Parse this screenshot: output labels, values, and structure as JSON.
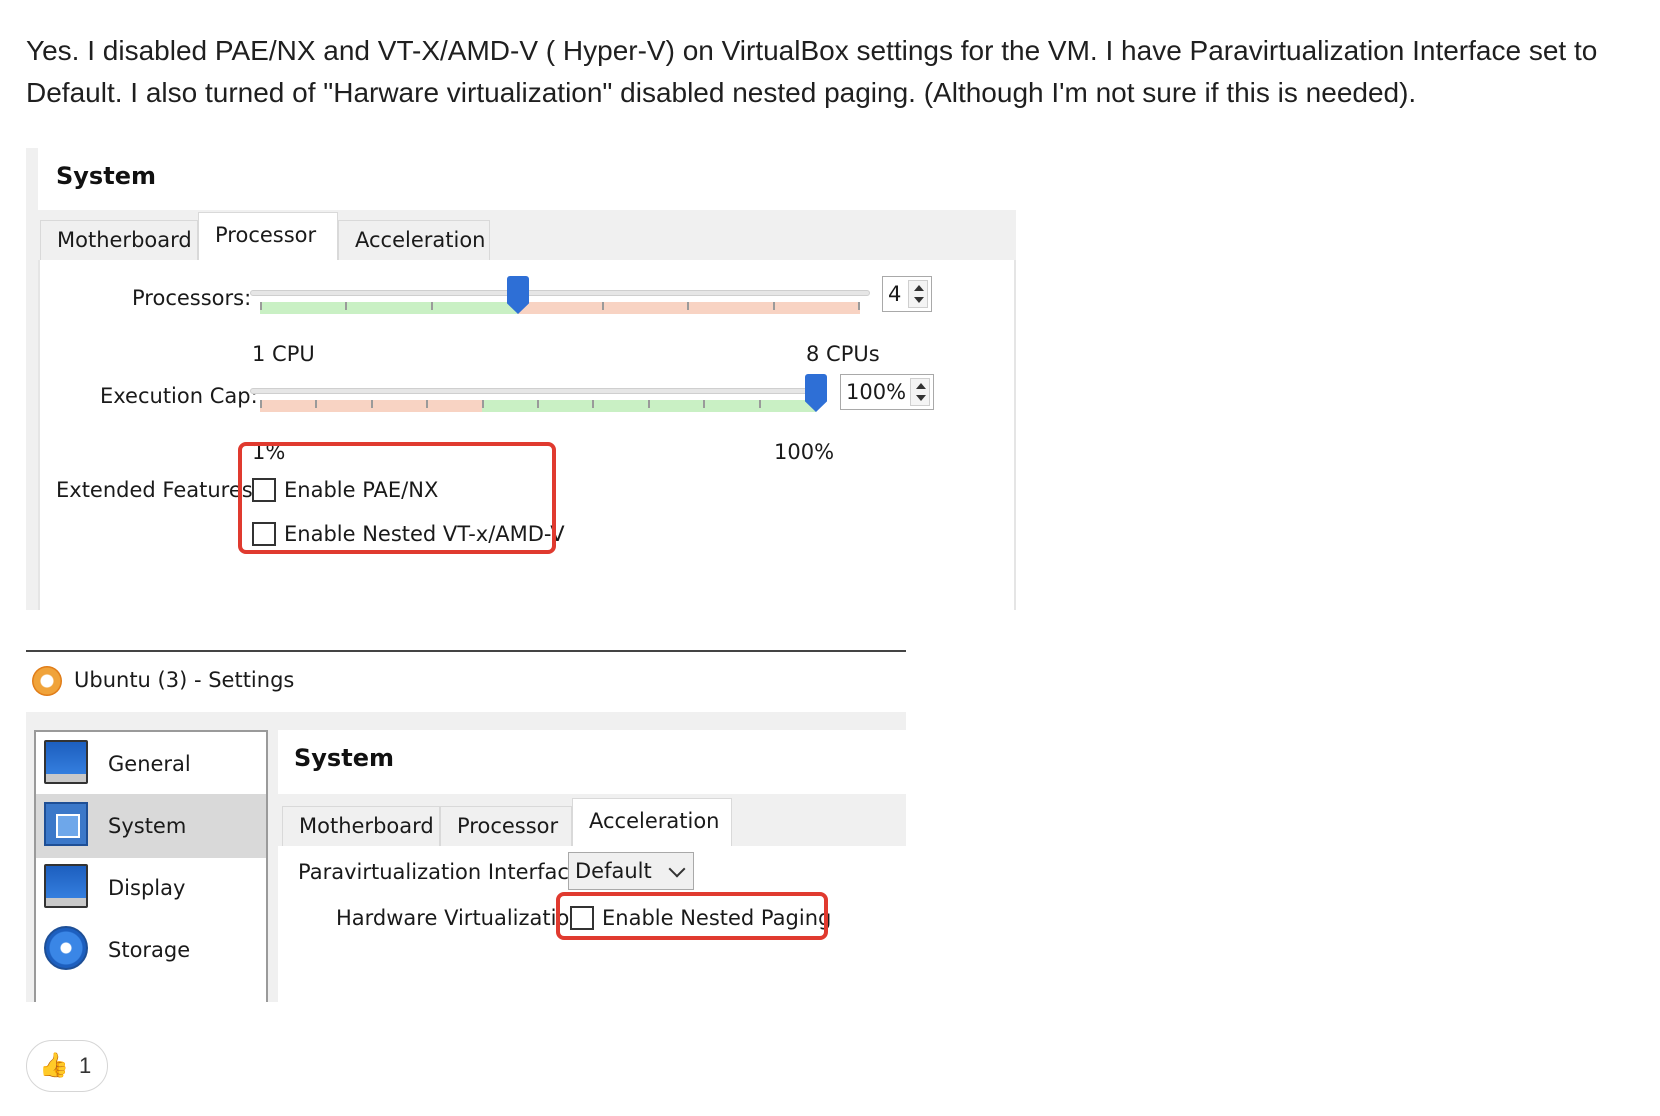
{
  "post": {
    "text": "Yes. I disabled PAE/NX and VT-X/AMD-V ( Hyper-V) on VirtualBox settings for the VM. I have Paravirtualization Interface set to Default. I also turned of \"Harware virtualization\" disabled nested paging. (Although I'm not sure if this is needed)."
  },
  "shot1": {
    "title": "System",
    "tabs": [
      "Motherboard",
      "Processor",
      "Acceleration"
    ],
    "active_tab": "Processor",
    "processors": {
      "label": "Processors:",
      "value": "4",
      "min_label": "1 CPU",
      "max_label": "8 CPUs",
      "level": 0.43
    },
    "execution_cap": {
      "label": "Execution Cap:",
      "value": "100%",
      "min_label": "1%",
      "max_label": "100%",
      "level": 1.0
    },
    "extended_features": {
      "label": "Extended Features:",
      "options": [
        {
          "label": "Enable PAE/NX",
          "checked": false
        },
        {
          "label": "Enable Nested VT-x/AMD-V",
          "checked": false
        }
      ]
    },
    "highlight_color": "#e03a2f"
  },
  "shot2": {
    "window_title": "Ubuntu (3) - Settings",
    "sidebar": [
      {
        "label": "General",
        "icon": "monitor-icon",
        "selected": false
      },
      {
        "label": "System",
        "icon": "chip-icon",
        "selected": true
      },
      {
        "label": "Display",
        "icon": "monitor-icon",
        "selected": false
      },
      {
        "label": "Storage",
        "icon": "disc-icon",
        "selected": false
      }
    ],
    "title": "System",
    "tabs": [
      "Motherboard",
      "Processor",
      "Acceleration"
    ],
    "active_tab": "Acceleration",
    "paravirt": {
      "label": "Paravirtualization Interface:",
      "value": "Default"
    },
    "hardware_virt": {
      "label": "Hardware Virtualization:",
      "option": "Enable Nested Paging",
      "checked": false
    }
  },
  "reaction": {
    "emoji": "👍",
    "count": "1"
  }
}
